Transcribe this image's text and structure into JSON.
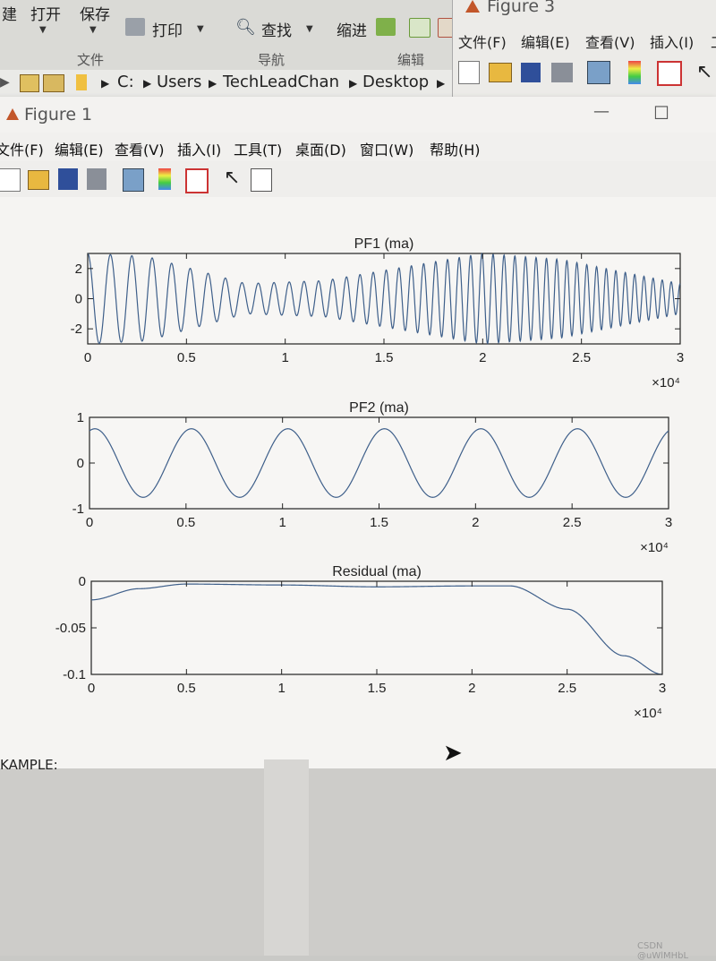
{
  "toolstrip": {
    "new_partial": "建",
    "open": "打开",
    "save": "保存",
    "print": "打印",
    "find": "查找",
    "indent": "缩进",
    "sections": [
      "文件",
      "导航",
      "编辑"
    ]
  },
  "address": {
    "crumbs": [
      "C:",
      "Users",
      "TechLeadChan",
      "Desktop"
    ]
  },
  "figure3": {
    "title": "Figure 3",
    "menu": [
      "文件(F)",
      "编辑(E)",
      "查看(V)",
      "插入(I)",
      "工"
    ]
  },
  "figure1": {
    "title": "Figure 1",
    "menu": [
      "文件(F)",
      "编辑(E)",
      "查看(V)",
      "插入(I)",
      "工具(T)",
      "桌面(D)",
      "窗口(W)",
      "帮助(H)"
    ],
    "minimize": "—",
    "maximize": "☐"
  },
  "colors": {
    "line": "#3e5f8a",
    "axes": "#222222",
    "background": "#f5f4f2"
  },
  "chart_data": [
    {
      "type": "line",
      "title": "PF1 (ma)",
      "xlim": [
        0,
        30000
      ],
      "ylim": [
        -3,
        3
      ],
      "xticks": [
        "0",
        "0.5",
        "1",
        "1.5",
        "2",
        "2.5",
        "3"
      ],
      "yticks": [
        "2",
        "0",
        "-2"
      ],
      "x_exponent": "×10⁴",
      "series": [
        {
          "description": "frequency-modulated oscillation, ~46 cycles; amplitude ≈3 near x=0, dips to ≈1 near x=8000, peaks ≈3 near x=20000, decays to ≈1 by x=30000",
          "cycles": 46,
          "amplitude_profile": [
            [
              0,
              3
            ],
            [
              3000,
              2.8
            ],
            [
              8000,
              1.0
            ],
            [
              12000,
              1.2
            ],
            [
              20000,
              3.0
            ],
            [
              24000,
              2.6
            ],
            [
              30000,
              1.0
            ]
          ]
        }
      ]
    },
    {
      "type": "line",
      "title": "PF2 (ma)",
      "xlim": [
        0,
        30000
      ],
      "ylim": [
        -1,
        1
      ],
      "xticks": [
        "0",
        "0.5",
        "1",
        "1.5",
        "2",
        "2.5",
        "3"
      ],
      "yticks": [
        "1",
        "0",
        "-1"
      ],
      "x_exponent": "×10⁴",
      "series": [
        {
          "description": "near-sinusoid, amplitude ≈0.75, period ≈5000",
          "amplitude": 0.75,
          "period": 5000,
          "start_value": 0.7
        }
      ]
    },
    {
      "type": "line",
      "title": "Residual (ma)",
      "xlim": [
        0,
        30000
      ],
      "ylim": [
        -0.1,
        0
      ],
      "xticks": [
        "0",
        "0.5",
        "1",
        "1.5",
        "2",
        "2.5",
        "3"
      ],
      "yticks": [
        "0",
        "-0.05",
        "-0.1"
      ],
      "x_exponent": "×10⁴",
      "series": [
        {
          "points": [
            [
              0,
              -0.02
            ],
            [
              2500,
              -0.008
            ],
            [
              5000,
              -0.003
            ],
            [
              10000,
              -0.004
            ],
            [
              15000,
              -0.006
            ],
            [
              20000,
              -0.005
            ],
            [
              22000,
              -0.005
            ],
            [
              25000,
              -0.03
            ],
            [
              28000,
              -0.08
            ],
            [
              30000,
              -0.1
            ]
          ]
        }
      ]
    }
  ],
  "bottom": {
    "example_label": "KAMPLE:",
    "watermark": "CSDN @uWlMHbL"
  }
}
